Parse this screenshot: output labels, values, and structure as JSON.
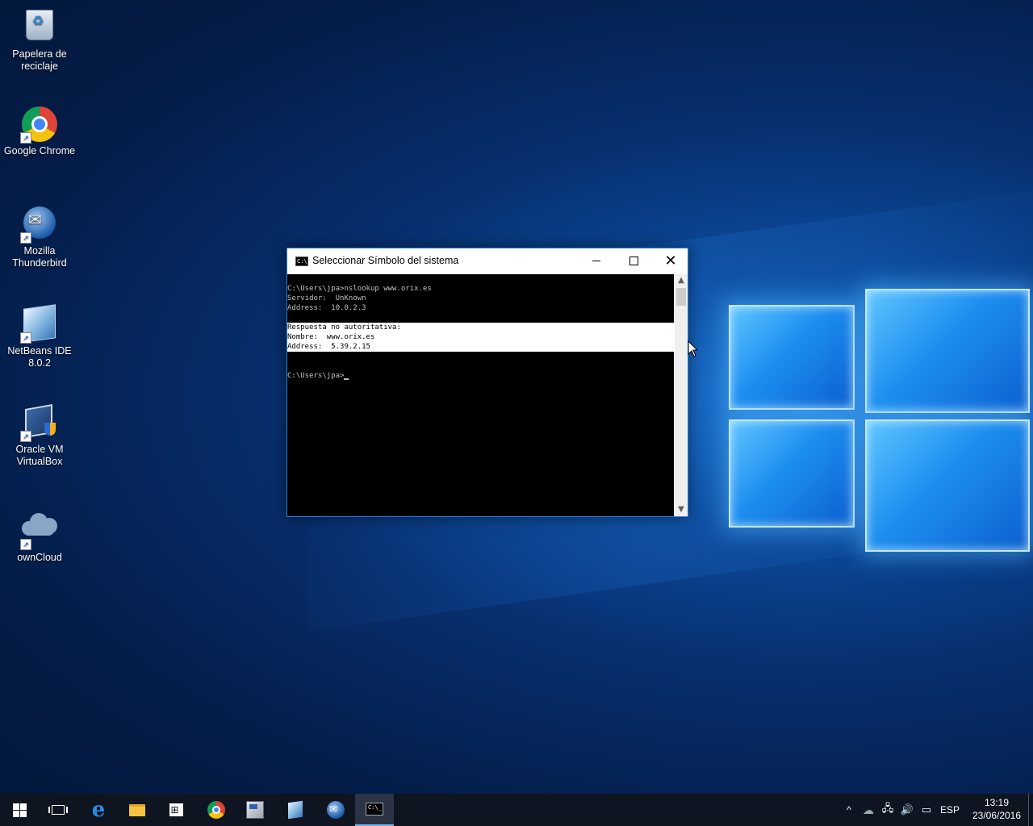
{
  "desktop": {
    "icons": [
      {
        "label": "Papelera de reciclaje",
        "icon": "recycle-bin-icon"
      },
      {
        "label": "Google Chrome",
        "icon": "chrome-icon"
      },
      {
        "label": "Mozilla Thunderbird",
        "icon": "thunderbird-icon"
      },
      {
        "label": "NetBeans IDE 8.0.2",
        "icon": "netbeans-icon"
      },
      {
        "label": "Oracle VM VirtualBox",
        "icon": "virtualbox-icon"
      },
      {
        "label": "ownCloud",
        "icon": "owncloud-icon"
      }
    ]
  },
  "cmd_window": {
    "title": "Seleccionar Símbolo del sistema",
    "icon_text": "C:\\_",
    "lines": [
      "C:\\Users\\jpa>nslookup www.orix.es",
      "Servidor:  UnKnown",
      "Address:  10.0.2.3",
      ""
    ],
    "selected_lines": [
      "Respuesta no autoritativa:",
      "Nombre:  www.orix.es",
      "Address:  5.39.2.15"
    ],
    "prompt": "C:\\Users\\jpa>"
  },
  "taskbar": {
    "items": [
      {
        "name": "start",
        "icon": "windows-start-icon"
      },
      {
        "name": "task-view",
        "icon": "task-view-icon"
      },
      {
        "name": "edge",
        "icon": "edge-icon"
      },
      {
        "name": "file-explorer",
        "icon": "folder-icon"
      },
      {
        "name": "store",
        "icon": "store-icon"
      },
      {
        "name": "chrome",
        "icon": "chrome-icon"
      },
      {
        "name": "tool",
        "icon": "app-icon"
      },
      {
        "name": "netbeans",
        "icon": "netbeans-icon"
      },
      {
        "name": "thunderbird",
        "icon": "thunderbird-icon"
      },
      {
        "name": "cmd",
        "icon": "cmd-icon"
      }
    ],
    "tray": {
      "language": "ESP",
      "time": "13:19",
      "date": "23/06/2016"
    }
  }
}
